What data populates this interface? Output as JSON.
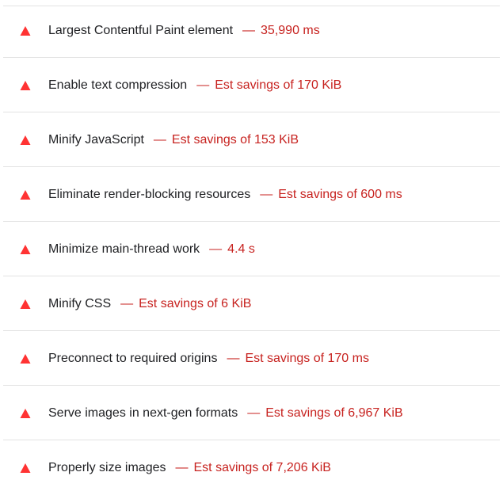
{
  "colors": {
    "fail_icon": "#ff3333",
    "fail_text": "#c7221f",
    "title_text": "#202124",
    "divider": "#e2e2e2"
  },
  "icon": "warning-triangle-icon",
  "separator": "—",
  "audits": [
    {
      "title": "Largest Contentful Paint element",
      "value": "35,990 ms"
    },
    {
      "title": "Enable text compression",
      "value": "Est savings of 170 KiB"
    },
    {
      "title": "Minify JavaScript",
      "value": "Est savings of 153 KiB"
    },
    {
      "title": "Eliminate render-blocking resources",
      "value": "Est savings of 600 ms"
    },
    {
      "title": "Minimize main-thread work",
      "value": "4.4 s"
    },
    {
      "title": "Minify CSS",
      "value": "Est savings of 6 KiB"
    },
    {
      "title": "Preconnect to required origins",
      "value": "Est savings of 170 ms"
    },
    {
      "title": "Serve images in next-gen formats",
      "value": "Est savings of 6,967 KiB"
    },
    {
      "title": "Properly size images",
      "value": "Est savings of 7,206 KiB"
    }
  ]
}
